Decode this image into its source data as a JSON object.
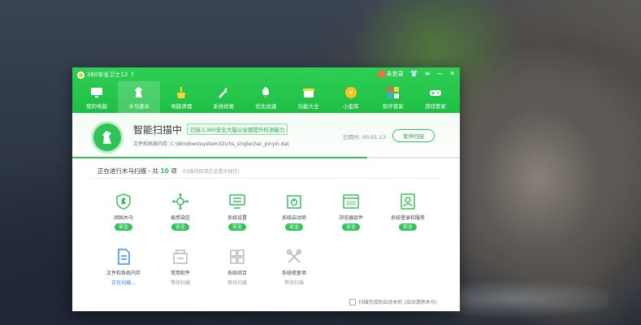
{
  "window": {
    "title": "360安全卫士12",
    "user_label": "未登录",
    "brand_color": "#25c54c"
  },
  "nav": [
    {
      "label": "我的电脑",
      "icon": "monitor-icon"
    },
    {
      "label": "木马查杀",
      "icon": "horse-icon",
      "active": true
    },
    {
      "label": "电脑清理",
      "icon": "broom-icon"
    },
    {
      "label": "系统修复",
      "icon": "wrench-icon"
    },
    {
      "label": "优化加速",
      "icon": "rocket-icon"
    },
    {
      "label": "功能大全",
      "icon": "box-icon"
    },
    {
      "label": "小金库",
      "icon": "coin-icon"
    },
    {
      "label": "软件管家",
      "icon": "apps-icon"
    },
    {
      "label": "游戏管家",
      "icon": "gamepad-icon"
    }
  ],
  "scan": {
    "title": "智能扫描中",
    "tag": "已接入360安全大脑以全面提升检测能力",
    "file_label": "文件和系统内存: C:\\Windows\\system32\\chs_singlechar_pinyin.dat",
    "elapsed_label": "已用时: 00:01:12",
    "pause_label": "暂停扫描",
    "progress": 0.76,
    "status_prefix": "正在进行木马扫描 - 共",
    "status_count": "10",
    "status_suffix": "项",
    "status_hint": "(扫描项目请在设置中保存)"
  },
  "items_row1": [
    {
      "label": "顽固木马",
      "status": "安全",
      "icon": "shield-icon"
    },
    {
      "label": "易感染区",
      "status": "安全",
      "icon": "virus-icon"
    },
    {
      "label": "系统设置",
      "status": "安全",
      "icon": "settings-screen-icon"
    },
    {
      "label": "系统启动项",
      "status": "安全",
      "icon": "startup-icon"
    },
    {
      "label": "浏览器组件",
      "status": "安全",
      "icon": "browser-icon"
    },
    {
      "label": "系统登录和服务",
      "status": "安全",
      "icon": "login-icon"
    }
  ],
  "items_row2": [
    {
      "label": "文件和系统内存",
      "status": "正在扫描...",
      "icon": "file-icon"
    },
    {
      "label": "常用软件",
      "status": "等待扫描",
      "icon": "software-icon"
    },
    {
      "label": "系统综合",
      "status": "等待扫描",
      "icon": "windows-icon"
    },
    {
      "label": "系统修复项",
      "status": "等待扫描",
      "icon": "repair-icon"
    }
  ],
  "footer": {
    "label": "扫描完成后自动关机 (自动清除木马)"
  }
}
